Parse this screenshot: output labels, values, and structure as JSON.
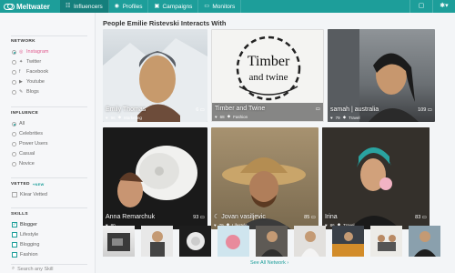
{
  "brand": {
    "name": "Meltwater"
  },
  "nav": {
    "items": [
      {
        "label": "Influencers",
        "icon": "people-icon",
        "active": true
      },
      {
        "label": "Profiles",
        "icon": "person-icon",
        "active": false
      },
      {
        "label": "Campaigns",
        "icon": "campaign-icon",
        "active": false
      },
      {
        "label": "Monitors",
        "icon": "monitor-icon",
        "active": false
      }
    ]
  },
  "sidebar": {
    "network": {
      "title": "NETWORK",
      "options": [
        "Instagram",
        "Twitter",
        "Facebook",
        "Youtube",
        "Blogs"
      ]
    },
    "influence": {
      "title": "INFLUENCE",
      "options": [
        "All",
        "Celebrities",
        "Power Users",
        "Casual",
        "Novice"
      ]
    },
    "vetted": {
      "title": "VETTED",
      "new": "NEW",
      "option": "Klear Vetted"
    },
    "skills": {
      "title": "SKILLS",
      "options": [
        "Blogger",
        "Lifestyle",
        "Blogging",
        "Fashion"
      ],
      "search_placeholder": "Search any Skill"
    }
  },
  "main": {
    "heading": "People Emilie Ristevski Interacts With",
    "cards": [
      {
        "name": "Emily Thomas",
        "count": "6",
        "followers": "96",
        "tag": "Marketing"
      },
      {
        "name": "Timber and Twine",
        "count": "",
        "followers": "68",
        "tag": "Fashion"
      },
      {
        "name": "samah | australia",
        "count": "109",
        "followers": "79",
        "tag": "Travel"
      },
      {
        "name": "Anna Remarchuk",
        "count": "93",
        "followers": "80",
        "tag": ""
      },
      {
        "name": "Jovan vasiljevic",
        "count": "85",
        "followers": "79",
        "tag": "Lifestyle"
      },
      {
        "name": "Irina",
        "count": "83",
        "followers": "86",
        "tag": "Travel"
      }
    ],
    "logo_text": {
      "line1": "Timber",
      "line2": "and twine"
    },
    "see_all": "See All Network"
  },
  "colors": {
    "accent": "#1d9e9a",
    "instagram": "#e05a8e"
  }
}
